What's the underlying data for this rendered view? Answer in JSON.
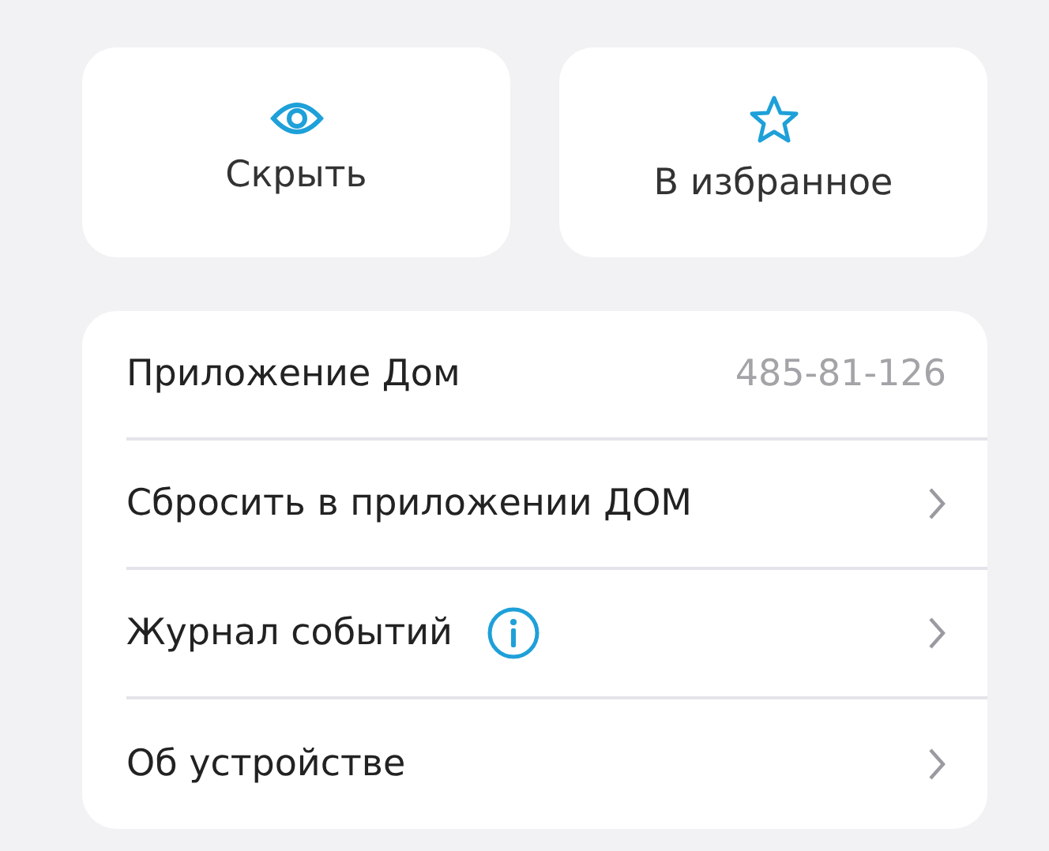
{
  "actions": [
    {
      "label": "Скрыть",
      "kind": "eye"
    },
    {
      "label": "В избранное",
      "kind": "star"
    }
  ],
  "rows": [
    {
      "label": "Приложение Дом",
      "kind": "value",
      "value": "485-81-126",
      "info": false
    },
    {
      "label": "Сбросить в приложении ДОМ",
      "kind": "link",
      "info": false
    },
    {
      "label": "Журнал событий",
      "kind": "link",
      "info": true
    },
    {
      "label": "Об устройстве",
      "kind": "link",
      "info": false
    }
  ]
}
